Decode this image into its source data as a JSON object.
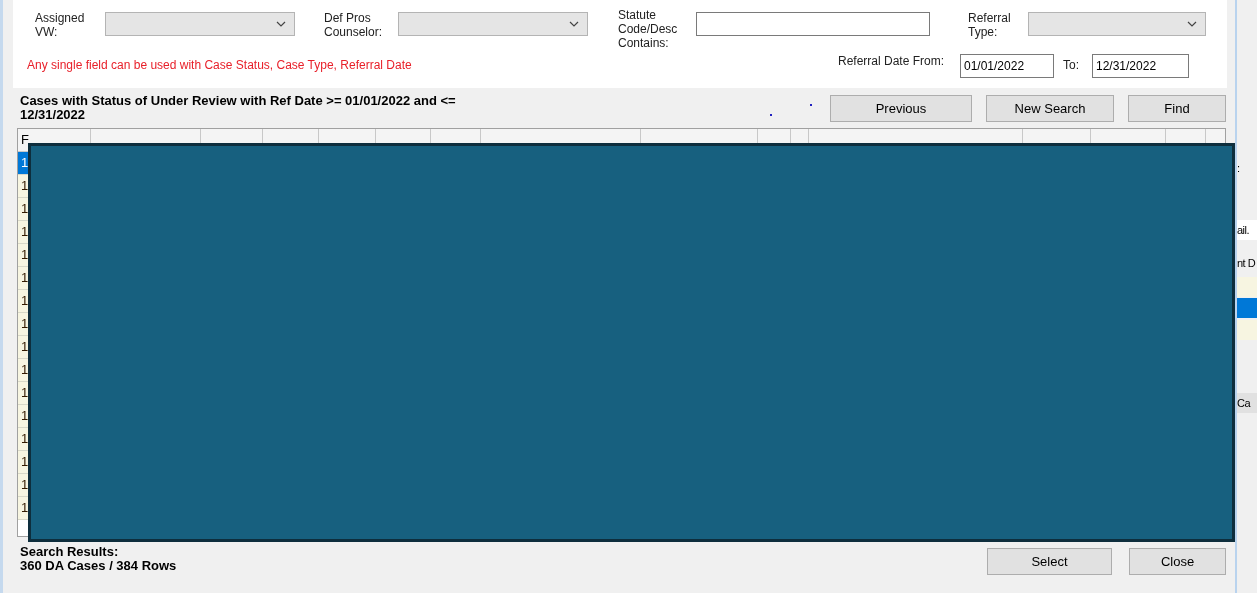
{
  "filters": {
    "assigned_vw": {
      "label": "Assigned VW:",
      "kind": "dropdown"
    },
    "def_pros_counselor": {
      "label": "Def Pros Counselor:",
      "kind": "dropdown"
    },
    "statute": {
      "label": "Statute Code/Desc Contains:",
      "kind": "text"
    },
    "referral_type": {
      "label": "Referral Type:",
      "kind": "dropdown"
    },
    "hint": "Any single field can be used with Case Status, Case Type, Referral Date",
    "referral_date_from": {
      "label": "Referral Date From:",
      "value": "01/01/2022"
    },
    "referral_date_to": {
      "label": "To:",
      "value": "12/31/2022"
    }
  },
  "results_title": "Cases with Status of Under Review with Ref Date >= 01/01/2022 and <= 12/31/2022",
  "buttons": [
    "Previous",
    "New Search",
    "Find"
  ],
  "table": {
    "header": "F",
    "rows": [
      {
        "cell": "1",
        "selected": true
      },
      {
        "cell": "1",
        "selected": false
      },
      {
        "cell": "1",
        "selected": false
      },
      {
        "cell": "1",
        "selected": false
      },
      {
        "cell": "1",
        "selected": false
      },
      {
        "cell": "1",
        "selected": false
      },
      {
        "cell": "1",
        "selected": false
      },
      {
        "cell": "1",
        "selected": false
      },
      {
        "cell": "1",
        "selected": false
      },
      {
        "cell": "1",
        "selected": false
      },
      {
        "cell": "1",
        "selected": false
      },
      {
        "cell": "1",
        "selected": false
      },
      {
        "cell": "1",
        "selected": false
      },
      {
        "cell": "1",
        "selected": false
      },
      {
        "cell": "1",
        "selected": false
      },
      {
        "cell": "1",
        "selected": false
      }
    ]
  },
  "status": {
    "label": "Search Results:",
    "summary": "360 DA Cases / 384 Rows"
  },
  "bottom_buttons": [
    "Select",
    "Close"
  ],
  "background_window": {
    "fragments": [
      ":",
      "ail.",
      "nt D",
      "Ca"
    ]
  }
}
